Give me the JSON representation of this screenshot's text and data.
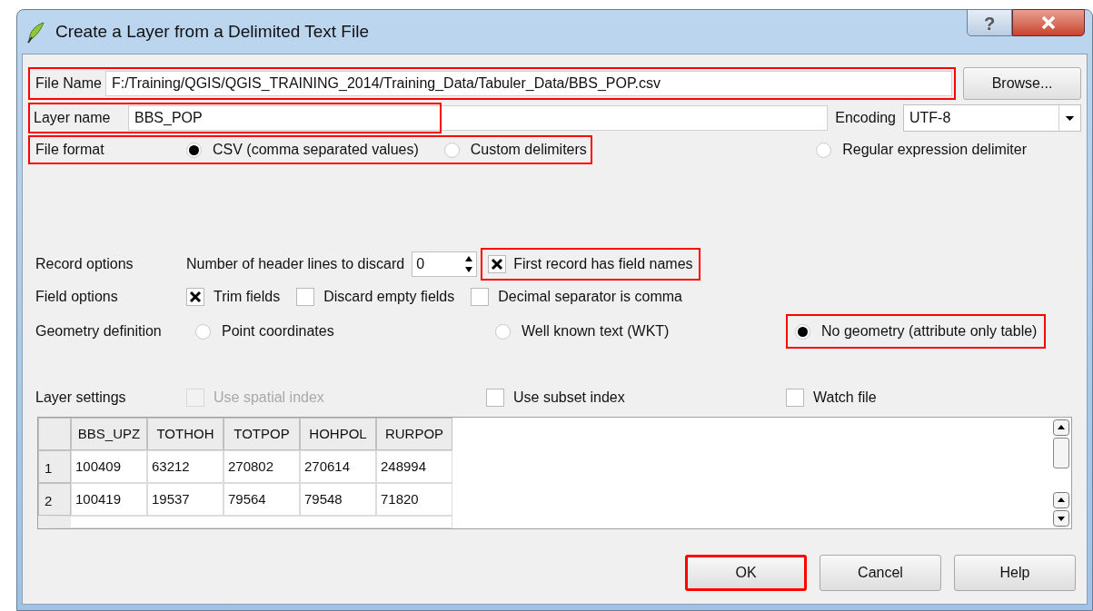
{
  "window": {
    "title": "Create a Layer from a Delimited Text File",
    "help_glyph": "?"
  },
  "file_name": {
    "label": "File Name",
    "value": "F:/Training/QGIS/QGIS_TRAINING_2014/Training_Data/Tabuler_Data/BBS_POP.csv",
    "highlighted": true,
    "button": "Browse..."
  },
  "layer_name": {
    "label": "Layer name",
    "value": "BBS_POP",
    "highlighted": true
  },
  "encoding": {
    "label": "Encoding",
    "value": "UTF-8"
  },
  "file_format": {
    "label": "File format",
    "highlighted": true,
    "options": [
      {
        "label": "CSV (comma separated values)",
        "selected": true,
        "highlighted": true
      },
      {
        "label": "Custom delimiters",
        "selected": false,
        "highlighted": true
      },
      {
        "label": "Regular expression delimiter",
        "selected": false,
        "highlighted": false
      }
    ]
  },
  "record_options": {
    "label": "Record options",
    "header_lines_label": "Number of header lines to discard",
    "header_lines": "0",
    "first_record": {
      "label": "First record has field names",
      "checked": true,
      "highlighted": true
    }
  },
  "field_options": {
    "label": "Field options",
    "items": [
      {
        "label": "Trim fields",
        "checked": true
      },
      {
        "label": "Discard empty fields",
        "checked": false
      },
      {
        "label": "Decimal separator is comma",
        "checked": false
      }
    ]
  },
  "geometry": {
    "label": "Geometry definition",
    "options": [
      {
        "label": "Point coordinates",
        "selected": false,
        "highlighted": false
      },
      {
        "label": "Well known text (WKT)",
        "selected": false,
        "highlighted": false
      },
      {
        "label": "No geometry (attribute only table)",
        "selected": true,
        "highlighted": true
      }
    ]
  },
  "layer_settings": {
    "label": "Layer settings",
    "items": [
      {
        "label": "Use spatial index",
        "checked": false,
        "disabled": true
      },
      {
        "label": "Use subset index",
        "checked": false,
        "disabled": false
      },
      {
        "label": "Watch file",
        "checked": false,
        "disabled": false
      }
    ]
  },
  "table": {
    "columns": [
      "BBS_UPZ",
      "TOTHOH",
      "TOTPOP",
      "HOHPOL",
      "RURPOP"
    ],
    "rows": [
      {
        "number": "1",
        "cells": [
          "100409",
          "63212",
          "270802",
          "270614",
          "248994"
        ]
      },
      {
        "number": "2",
        "cells": [
          "100419",
          "19537",
          "79564",
          "79548",
          "71820"
        ]
      }
    ]
  },
  "buttons": [
    {
      "label": "OK",
      "highlighted": true
    },
    {
      "label": "Cancel",
      "highlighted": false
    },
    {
      "label": "Help",
      "highlighted": false
    }
  ]
}
